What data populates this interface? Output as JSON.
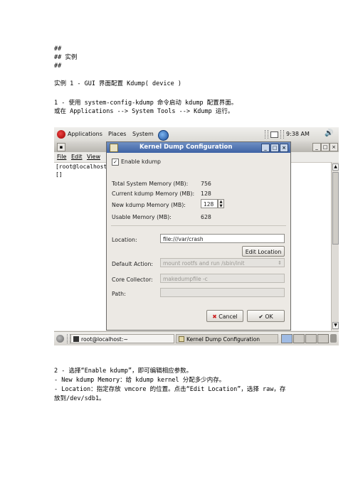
{
  "doc": {
    "h1": "##",
    "h2": "## 实例",
    "h3": "##",
    "example_title": "实例 1 - GUI 界面配置 Kdump( device )",
    "step1_line1": "1 - 使用 system-config-kdump 命令启动 kdump 配置界面。",
    "step1_line2": "或在 Applications --> System Tools --> Kdump 运行。",
    "step2_line1": "2 - 选择“Enable kdump”，即可编辑相应参数。",
    "step2_line2": "- New kdump Memory：给 kdump kernel 分配多少内存。",
    "step2_line3": "- Location：指定存放 vmcore 的位置。点击“Edit Location”，选择 raw，存",
    "step2_line4": "放到/dev/sdb1。"
  },
  "screenshot": {
    "top_panel": {
      "applications": "Applications",
      "places": "Places",
      "system": "System",
      "clock": "9:38 AM"
    },
    "terminal": {
      "menu_file": "File",
      "menu_edit": "Edit",
      "menu_view": "View",
      "prompt": "[root@localhost",
      "cursor": "[]"
    },
    "dialog": {
      "title": "Kernel Dump Configuration",
      "enable_label": "Enable kdump",
      "enable_checked": true,
      "total_memory_label": "Total System Memory (MB):",
      "total_memory_value": "756",
      "current_memory_label": "Current kdump Memory (MB):",
      "current_memory_value": "128",
      "new_memory_label": "New kdump Memory (MB):",
      "new_memory_value": "128",
      "usable_memory_label": "Usable Memory (MB):",
      "usable_memory_value": "628",
      "location_label": "Location:",
      "location_value": "file:///var/crash",
      "edit_location_button": "Edit Location",
      "default_action_label": "Default Action:",
      "default_action_value": "mount rootfs and run /sbin/init",
      "core_collector_label": "Core Collector:",
      "core_collector_value": "makedumpfile -c",
      "path_label": "Path:",
      "path_value": "",
      "cancel_button": "Cancel",
      "ok_button": "OK"
    },
    "taskbar": {
      "task_terminal": "root@localhost:~",
      "task_kdump": "Kernel Dump Configuration"
    },
    "colors": {
      "titlebar": "#3e62a5",
      "panel": "#dcdad5",
      "workspace_active": "#9fbbe4"
    }
  }
}
